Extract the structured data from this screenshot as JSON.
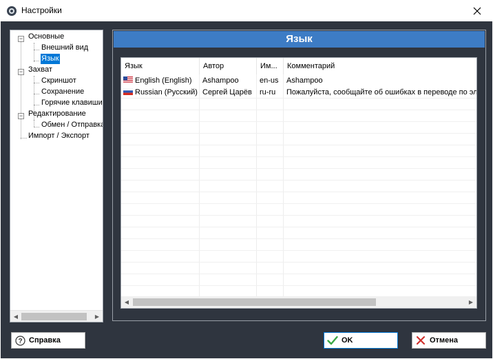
{
  "window": {
    "title": "Настройки"
  },
  "tree": {
    "items": [
      {
        "label": "Основные",
        "level": 0,
        "expandable": true
      },
      {
        "label": "Внешний вид",
        "level": 1
      },
      {
        "label": "Язык",
        "level": 1,
        "selected": true
      },
      {
        "label": "Захват",
        "level": 0,
        "expandable": true
      },
      {
        "label": "Скриншот",
        "level": 1
      },
      {
        "label": "Сохранение",
        "level": 1
      },
      {
        "label": "Горячие клавиши",
        "level": 1
      },
      {
        "label": "Редактирование",
        "level": 0,
        "expandable": true
      },
      {
        "label": "Обмен / Отправка",
        "level": 1
      },
      {
        "label": "Импорт / Экспорт",
        "level": 0
      }
    ]
  },
  "panel": {
    "title": "Язык"
  },
  "table": {
    "columns": [
      "Язык",
      "Автор",
      "Им...",
      "Комментарий"
    ],
    "rows": [
      {
        "lang": "English (English)",
        "author": "Ashampoo",
        "code": "en-us",
        "comment": "Ashampoo",
        "flag": "us-flag-icon"
      },
      {
        "lang": "Russian (Русский)",
        "author": "Сергей Царёв",
        "code": "ru-ru",
        "comment": "Пожалуйста, сообщайте об ошибках в переводе по эл",
        "flag": "ru-flag-icon"
      }
    ]
  },
  "buttons": {
    "help": "Справка",
    "ok": "OK",
    "cancel": "Отмена"
  },
  "colors": {
    "background": "#2f353f",
    "header": "#3d7cc5",
    "selection": "#0078d7"
  }
}
